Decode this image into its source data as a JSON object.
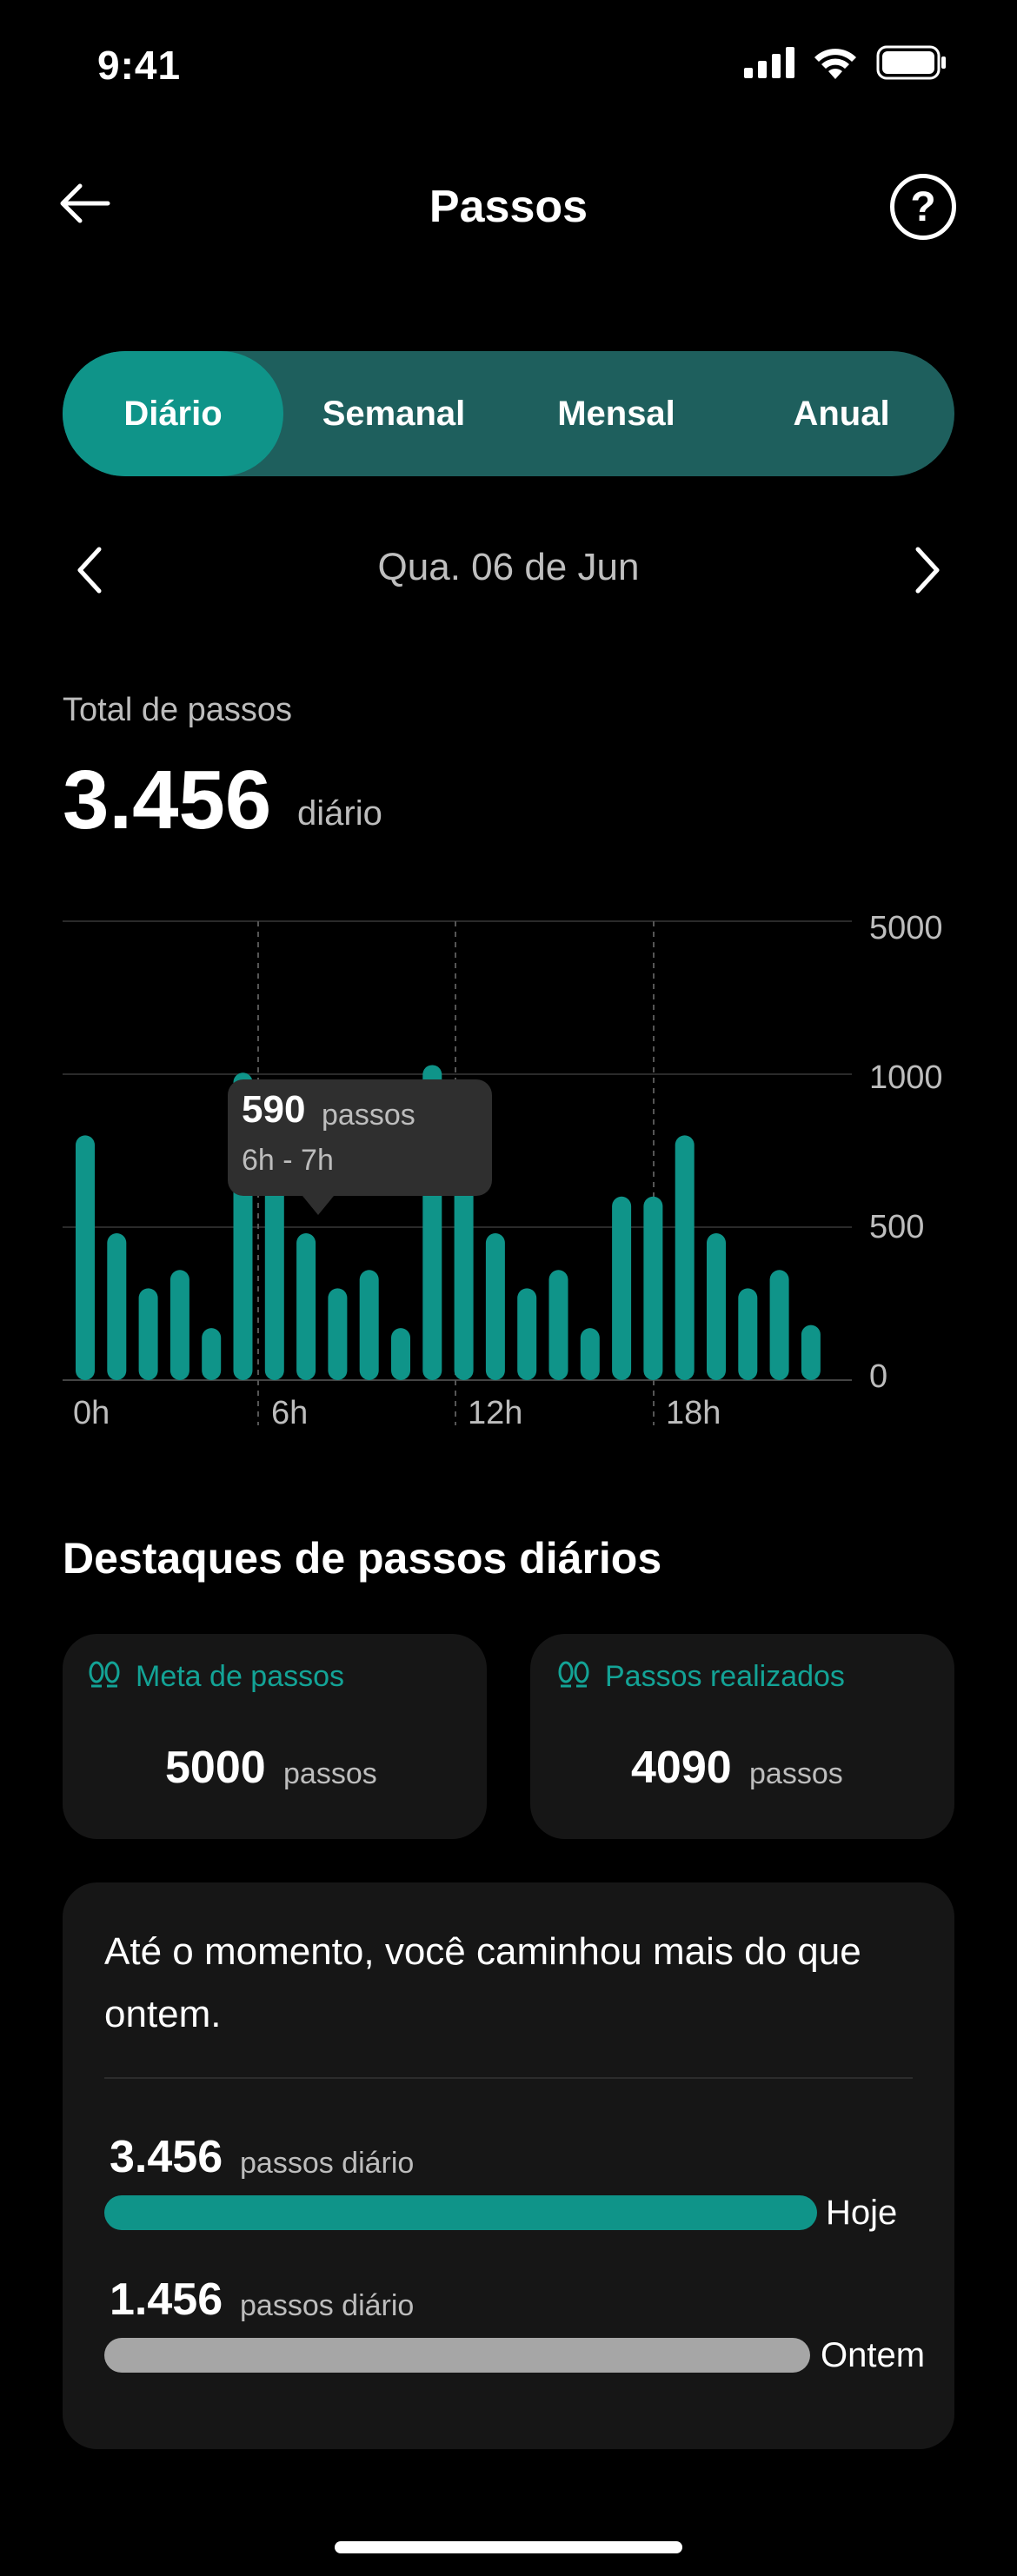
{
  "status_bar": {
    "time": "9:41"
  },
  "header": {
    "title": "Passos"
  },
  "tabs": [
    {
      "label": "Diário",
      "active": true
    },
    {
      "label": "Semanal",
      "active": false
    },
    {
      "label": "Mensal",
      "active": false
    },
    {
      "label": "Anual",
      "active": false
    }
  ],
  "date_nav": {
    "date": "Qua. 06 de Jun"
  },
  "total": {
    "label": "Total de passos",
    "value": "3.456",
    "unit": "diário"
  },
  "tooltip": {
    "value": "590",
    "unit": "passos",
    "range": "6h - 7h"
  },
  "chart_data": {
    "type": "bar",
    "x_tick_labels": [
      "0h",
      "6h",
      "12h",
      "18h"
    ],
    "y_tick_labels": [
      "5000",
      "1000",
      "500",
      "0"
    ],
    "categories": [
      "0h",
      "1h",
      "2h",
      "3h",
      "4h",
      "5h",
      "6h",
      "7h",
      "8h",
      "9h",
      "10h",
      "11h",
      "12h",
      "13h",
      "14h",
      "15h",
      "16h",
      "17h",
      "18h",
      "19h",
      "20h",
      "21h",
      "22h",
      "23h"
    ],
    "values": [
      800,
      480,
      300,
      360,
      170,
      1040,
      800,
      480,
      300,
      360,
      170,
      1240,
      800,
      480,
      300,
      360,
      170,
      600,
      600,
      800,
      480,
      300,
      360,
      180
    ],
    "color": "#0f9489",
    "grid": true
  },
  "highlights": {
    "title": "Destaques de passos diários",
    "goal": {
      "title": "Meta de passos",
      "value": "5000",
      "unit": "passos"
    },
    "done": {
      "title": "Passos realizados",
      "value": "4090",
      "unit": "passos"
    }
  },
  "comparison": {
    "text": "Até o momento, você caminhou mais do que ontem.",
    "today": {
      "value": "3.456",
      "unit": "passos diário",
      "label": "Hoje",
      "color": "#0f9489"
    },
    "yesterday": {
      "value": "1.456",
      "unit": "passos diário",
      "label": "Ontem",
      "color": "#a6a6a6"
    }
  }
}
